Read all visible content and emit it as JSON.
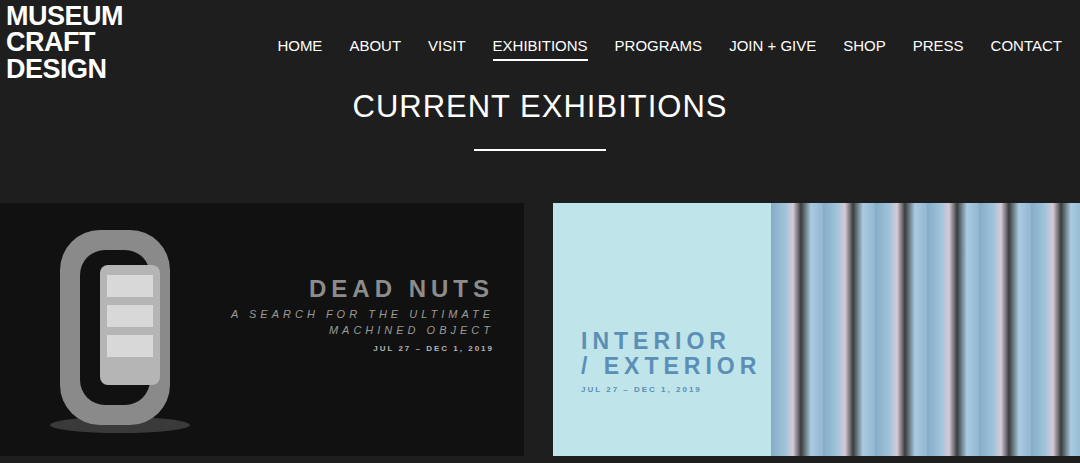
{
  "logo": {
    "lines": [
      "MUSEUM",
      "CRAFT",
      "DESIGN"
    ]
  },
  "nav": [
    {
      "label": "HOME",
      "selected": false
    },
    {
      "label": "ABOUT",
      "selected": false
    },
    {
      "label": "VISIT",
      "selected": false
    },
    {
      "label": "EXHIBITIONS",
      "selected": true
    },
    {
      "label": "PROGRAMS",
      "selected": false
    },
    {
      "label": "JOIN + GIVE",
      "selected": false
    },
    {
      "label": "SHOP",
      "selected": false
    },
    {
      "label": "PRESS",
      "selected": false
    },
    {
      "label": "CONTACT",
      "selected": false
    }
  ],
  "heading": "CURRENT EXHIBITIONS",
  "exhibitions": [
    {
      "kind": "dark",
      "title": [
        "DEAD NUTS"
      ],
      "subtitle": [
        "A SEARCH FOR THE ULTIMATE",
        "MACHINED OBJECT"
      ],
      "dates": "JUL 27 – DEC 1, 2019"
    },
    {
      "kind": "light",
      "title": [
        "INTERIOR",
        "/ EXTERIOR"
      ],
      "subtitle": [],
      "dates": "JUL 27 – DEC 1, 2019"
    }
  ]
}
